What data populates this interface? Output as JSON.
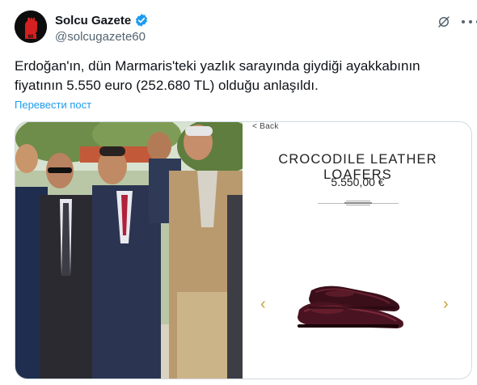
{
  "author": {
    "display_name": "Solcu Gazete",
    "handle": "@solcugazete60",
    "avatar_icon": "raised-fist-logo",
    "avatar_badge": "60",
    "verified": true
  },
  "tweet": {
    "text": "Erdoğan'ın, dün Marmaris'teki yazlık sarayında giydiği ayakkabının fiyatının 5.550 euro (252.680 TL) olduğu anlaşıldı.",
    "translate_label": "Перевести пост"
  },
  "header_actions": {
    "grok_icon": "grok-icon",
    "more_icon": "more-dots-icon"
  },
  "media": {
    "left_photo": "group-of-men-in-suits-outdoors",
    "product_page": {
      "back_label": "< Back",
      "title": "CROCODILE LEATHER LOAFERS",
      "price": "5.550,00 €",
      "prev_icon": "chevron-left-icon",
      "next_icon": "chevron-right-icon",
      "image": "burgundy-crocodile-loafers"
    }
  },
  "colors": {
    "link": "#1d9bf0",
    "verified": "#1d9bf0",
    "secondary_text": "#536471",
    "arrow_gold": "#c9a03a"
  }
}
